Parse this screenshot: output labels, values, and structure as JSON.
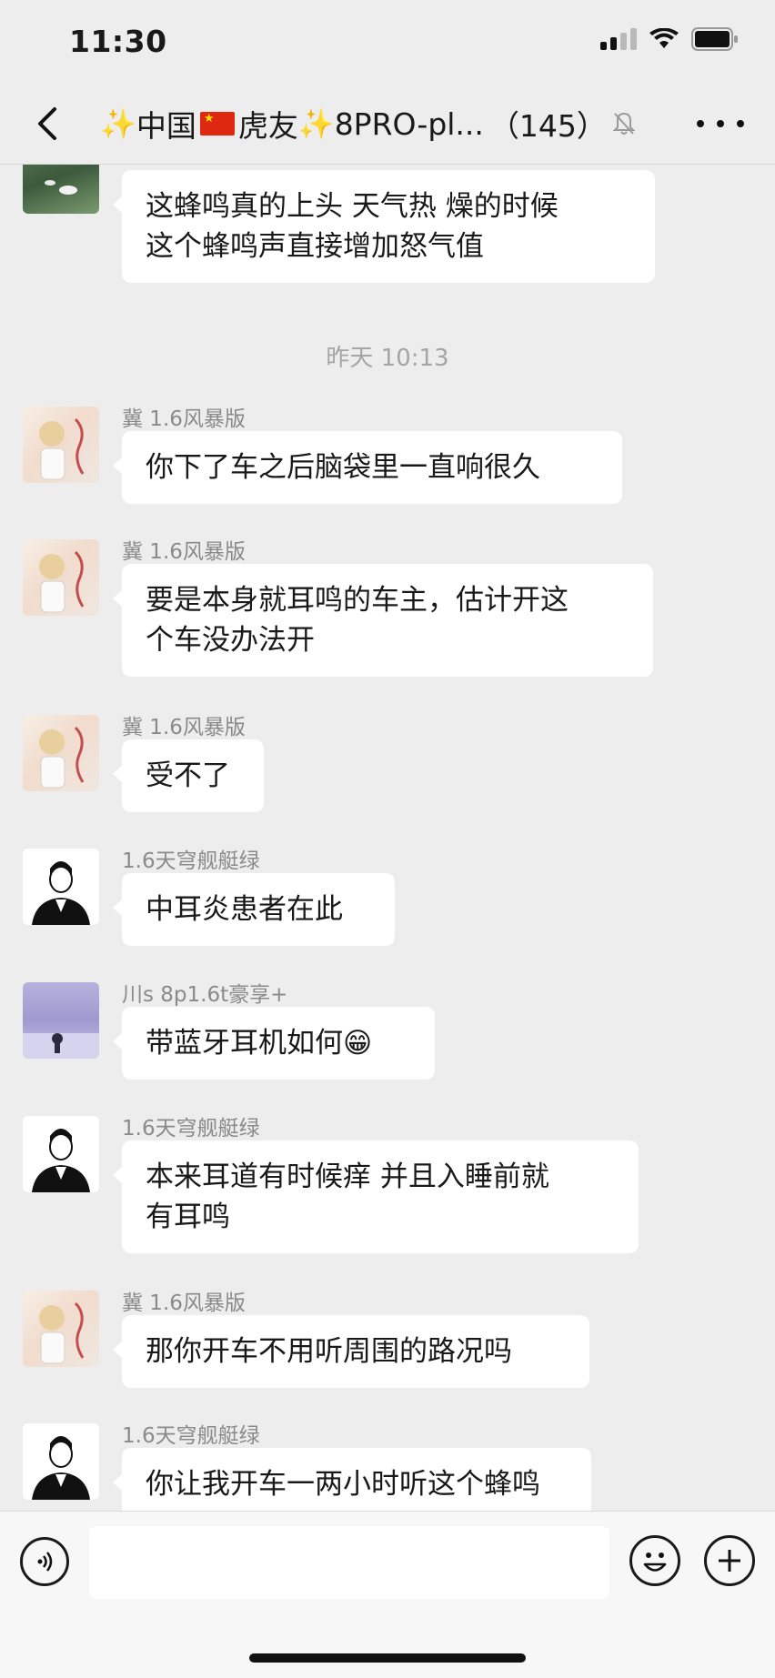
{
  "status_bar": {
    "time": "11:30"
  },
  "nav": {
    "sparkle_left": "✨",
    "title_part1": "中国",
    "title_part2": "虎友",
    "sparkle_mid": "✨",
    "title_part3": "8PRO-pl...",
    "member_count": "（145）",
    "icons": [
      "back-chevron-icon",
      "china-flag-icon",
      "mute-bell-icon",
      "more-icon"
    ]
  },
  "messages": [
    {
      "sender": "",
      "text": "这蜂鸣真的上头  天气热 燥的时候\n  这个蜂鸣声直接增加怒气值",
      "avatar": "pond"
    },
    {
      "timestamp": "昨天 10:13"
    },
    {
      "sender": "冀 1.6风暴版",
      "text": "你下了车之后脑袋里一直响很久",
      "avatar": "anime"
    },
    {
      "sender": "冀 1.6风暴版",
      "text": "要是本身就耳鸣的车主，估计开这\n个车没办法开",
      "avatar": "anime"
    },
    {
      "sender": "冀 1.6风暴版",
      "text": "受不了",
      "avatar": "anime"
    },
    {
      "sender": "1.6天穹舰艇绿",
      "text": "中耳炎患者在此",
      "avatar": "person"
    },
    {
      "sender": "川s 8p1.6t豪享+",
      "text": "带蓝牙耳机如何",
      "emoji": "😁",
      "avatar": "sky"
    },
    {
      "sender": "1.6天穹舰艇绿",
      "text": "本来耳道有时候痒  并且入睡前就\n有耳鸣",
      "avatar": "person"
    },
    {
      "sender": "冀 1.6风暴版",
      "text": "那你开车不用听周围的路况吗",
      "avatar": "anime"
    },
    {
      "sender": "1.6天穹舰艇绿",
      "text": "你让我开车一两小时听这个蜂鸣",
      "avatar": "person"
    }
  ],
  "input_bar": {
    "value": "",
    "icons": [
      "voice-icon",
      "emoji-icon",
      "plus-icon"
    ]
  },
  "colors": {
    "background": "#ededed",
    "bubble": "#ffffff",
    "sender": "#8a8a8a",
    "timestamp": "#a5a5a5"
  }
}
